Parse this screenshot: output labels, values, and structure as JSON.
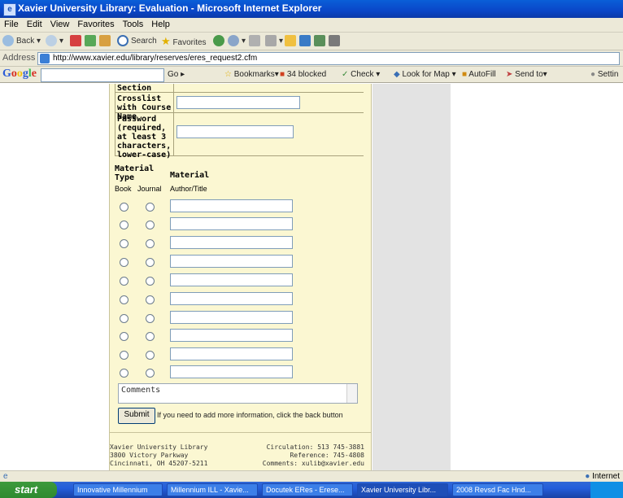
{
  "window": {
    "title": "Xavier University Library: Evaluation - Microsoft Internet Explorer"
  },
  "menu": [
    "File",
    "Edit",
    "View",
    "Favorites",
    "Tools",
    "Help"
  ],
  "toolbar": {
    "back": "Back",
    "search": "Search",
    "favorites": "Favorites"
  },
  "address": {
    "label": "Address",
    "url": "http://www.xavier.edu/library/reserves/eres_request2.cfm"
  },
  "google_toolbar": {
    "logo": "Google",
    "go": "Go",
    "bookmarks": "Bookmarks",
    "blocked": "34 blocked",
    "check": "Check",
    "look_for_map": "Look for Map",
    "autofill": "AutoFill",
    "send_to": "Send to",
    "settings": "Settin"
  },
  "form": {
    "section_label": "Section",
    "crosslist_label": "Crosslist with Course Name",
    "password_label": "Password (required, at least 3 characters, lower-case)",
    "material_type_header": "Material Type",
    "material_header": "Material",
    "book_label": "Book",
    "journal_label": "Journal",
    "author_title_label": "Author/Title",
    "comments_placeholder": "Comments",
    "submit_label": "Submit",
    "submit_note": "If you need to add more information, click the back button"
  },
  "footer": {
    "left_line1": "Xavier University Library",
    "left_line2": "3800 Victory Parkway",
    "left_line3": "Cincinnati, OH 45207-5211",
    "right_line1": "Circulation: 513 745-3881",
    "right_line2": "Reference: 745-4808",
    "right_line3": "Comments: xulib@xavier.edu"
  },
  "status": {
    "zone": "Internet"
  },
  "taskbar": {
    "start": "start",
    "items": [
      "Innovative Millennium",
      "Millennium ILL - Xavie...",
      "Docutek ERes - Erese...",
      "Xavier University Libr...",
      "2008 Revsd Fac Hnd..."
    ]
  }
}
